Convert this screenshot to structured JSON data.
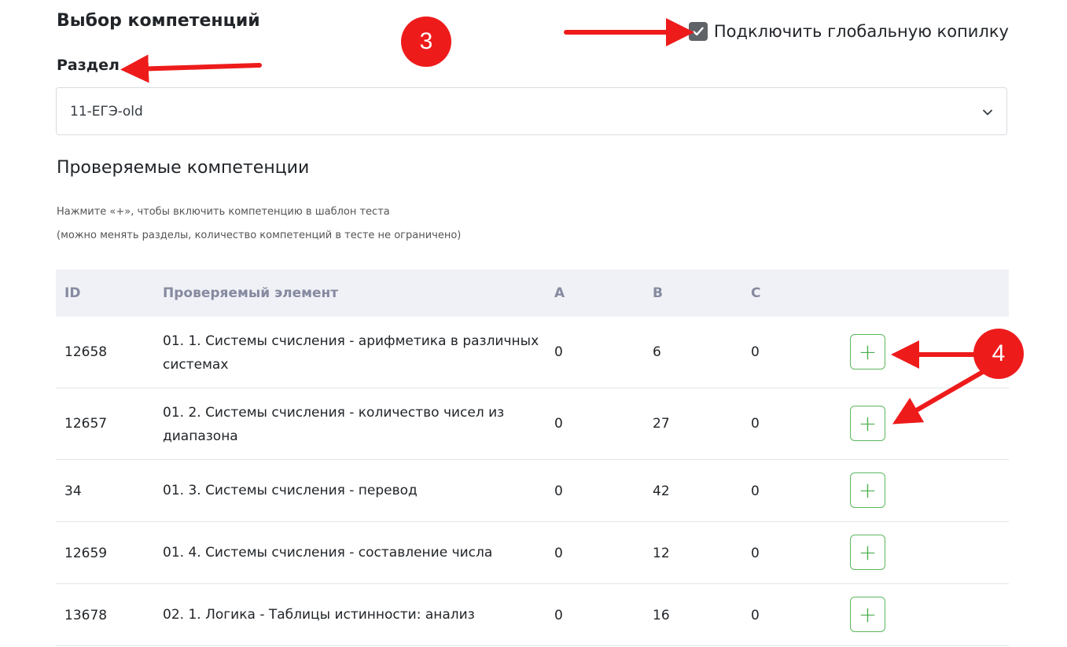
{
  "header": {
    "title": "Выбор компетенций",
    "global_label": "Подключить глобальную копилку",
    "global_checked": true
  },
  "section": {
    "label": "Раздел",
    "selected": "11-ЕГЭ-old"
  },
  "competencies": {
    "title": "Проверяемые компетенции",
    "hint1": "Нажмите «+», чтобы включить компетенцию в шаблон теста",
    "hint2": "(можно менять разделы, количество компетенций в тесте не ограничено)"
  },
  "table": {
    "headers": [
      "ID",
      "Проверяемый элемент",
      "A",
      "B",
      "C"
    ],
    "rows": [
      {
        "id": "12658",
        "name": "01. 1. Системы счисления - арифметика в различных системах",
        "a": "0",
        "b": "6",
        "c": "0",
        "add": "+"
      },
      {
        "id": "12657",
        "name": "01. 2. Системы счисления - количество чисел из диапазона",
        "a": "0",
        "b": "27",
        "c": "0",
        "add": "+"
      },
      {
        "id": "34",
        "name": "01. 3. Системы счисления - перевод",
        "a": "0",
        "b": "42",
        "c": "0",
        "add": "+"
      },
      {
        "id": "12659",
        "name": "01. 4. Системы счисления - составление числа",
        "a": "0",
        "b": "12",
        "c": "0",
        "add": "+"
      },
      {
        "id": "13678",
        "name": "02. 1. Логика - Таблицы истинности: анализ",
        "a": "0",
        "b": "16",
        "c": "0",
        "add": "+"
      }
    ]
  },
  "annotations": {
    "marker_3": "3",
    "marker_4": "4",
    "color": "#ee1b1b"
  },
  "icons": {
    "checkbox": "check-icon",
    "select": "chevron-down-icon",
    "add": "plus-icon"
  }
}
